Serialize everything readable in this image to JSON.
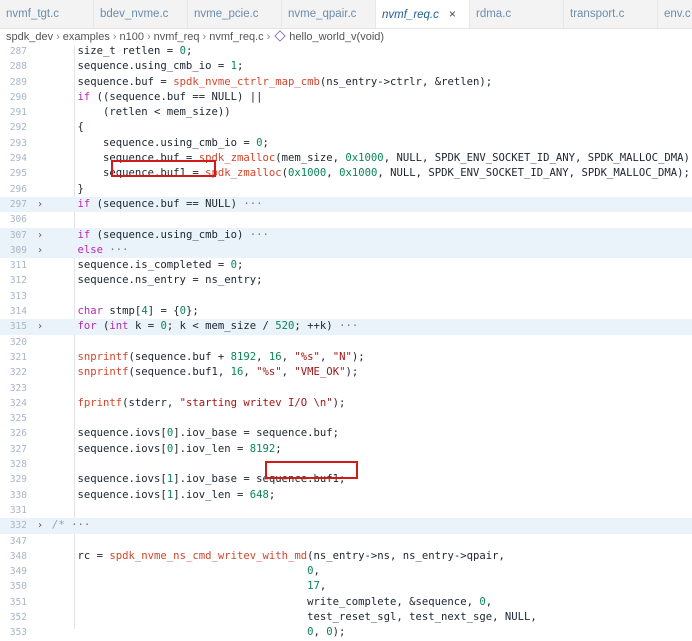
{
  "tabs": [
    {
      "label": "nvmf_tgt.c"
    },
    {
      "label": "bdev_nvme.c"
    },
    {
      "label": "nvme_pcie.c"
    },
    {
      "label": "nvme_qpair.c"
    },
    {
      "label": "nvmf_req.c",
      "close": "×"
    },
    {
      "label": "rdma.c"
    },
    {
      "label": "transport.c"
    },
    {
      "label": "env.c"
    }
  ],
  "breadcrumb": {
    "items": [
      "spdk_dev",
      "examples",
      "n100",
      "nvmf_req",
      "nvmf_req.c"
    ],
    "function": "hello_world_v(void)"
  },
  "colors": {
    "highlight_box": "#d11a1a",
    "keyword": "#b52ab5",
    "function": "#d5452b",
    "number": "#098658"
  },
  "lines": [
    {
      "n": "287",
      "t": "size_t retlen = 0;",
      "i": 4
    },
    {
      "n": "288",
      "t": "sequence.using_cmb_io = 1;",
      "i": 4
    },
    {
      "n": "289",
      "t": "sequence.buf = spdk_nvme_ctrlr_map_cmb(ns_entry->ctrlr, &retlen);",
      "i": 4
    },
    {
      "n": "290",
      "t": "if ((sequence.buf == NULL) ||",
      "i": 4
    },
    {
      "n": "291",
      "t": "(retlen < mem_size))",
      "i": 8
    },
    {
      "n": "292",
      "t": "{",
      "i": 4
    },
    {
      "n": "293",
      "t": "sequence.using_cmb_io = 0;",
      "i": 8
    },
    {
      "n": "294",
      "t": "sequence.buf = spdk_zmalloc(mem_size, 0x1000, NULL, SPDK_ENV_SOCKET_ID_ANY, SPDK_MALLOC_DMA);",
      "i": 8
    },
    {
      "n": "295",
      "t": "sequence.buf1 = spdk_zmalloc(0x1000, 0x1000, NULL, SPDK_ENV_SOCKET_ID_ANY, SPDK_MALLOC_DMA);",
      "i": 8
    },
    {
      "n": "296",
      "t": "}",
      "i": 4
    },
    {
      "n": "297",
      "t": "if (sequence.buf == NULL)",
      "i": 4,
      "fold": "›",
      "ell": "···"
    },
    {
      "n": "306",
      "t": "",
      "i": 0
    },
    {
      "n": "307",
      "t": "if (sequence.using_cmb_io)",
      "i": 4,
      "fold": "›",
      "ell": "···"
    },
    {
      "n": "309",
      "t": "else",
      "i": 4,
      "fold": "›",
      "ell": "···"
    },
    {
      "n": "311",
      "t": "sequence.is_completed = 0;",
      "i": 4
    },
    {
      "n": "312",
      "t": "sequence.ns_entry = ns_entry;",
      "i": 4
    },
    {
      "n": "313",
      "t": "",
      "i": 0
    },
    {
      "n": "314",
      "t": "char stmp[4] = {0};",
      "i": 4
    },
    {
      "n": "315",
      "t": "for (int k = 0; k < mem_size / 520; ++k)",
      "i": 4,
      "fold": "›",
      "ell": "···"
    },
    {
      "n": "320",
      "t": "",
      "i": 0
    },
    {
      "n": "321",
      "t": "snprintf(sequence.buf + 8192, 16, \"%s\", \"N\");",
      "i": 4
    },
    {
      "n": "322",
      "t": "snprintf(sequence.buf1, 16, \"%s\", \"VME_OK\");",
      "i": 4
    },
    {
      "n": "323",
      "t": "",
      "i": 0
    },
    {
      "n": "324",
      "t": "fprintf(stderr, \"starting writev I/O \\n\");",
      "i": 4
    },
    {
      "n": "325",
      "t": "",
      "i": 0
    },
    {
      "n": "326",
      "t": "sequence.iovs[0].iov_base = sequence.buf;",
      "i": 4
    },
    {
      "n": "327",
      "t": "sequence.iovs[0].iov_len = 8192;",
      "i": 4
    },
    {
      "n": "328",
      "t": "",
      "i": 0
    },
    {
      "n": "329",
      "t": "sequence.iovs[1].iov_base = sequence.buf1;",
      "i": 4
    },
    {
      "n": "330",
      "t": "sequence.iovs[1].iov_len = 648;",
      "i": 4
    },
    {
      "n": "331",
      "t": "",
      "i": 0
    },
    {
      "n": "332",
      "t": "/*",
      "i": 0,
      "fold": "›",
      "ell": "···",
      "comment": true
    },
    {
      "n": "347",
      "t": "",
      "i": 0
    },
    {
      "n": "348",
      "t": "rc = spdk_nvme_ns_cmd_writev_with_md(ns_entry->ns, ns_entry->qpair,",
      "i": 4
    },
    {
      "n": "349",
      "t": "0,",
      "i": 40
    },
    {
      "n": "350",
      "t": "17,",
      "i": 40
    },
    {
      "n": "351",
      "t": "write_complete, &sequence, 0,",
      "i": 40
    },
    {
      "n": "352",
      "t": "test_reset_sgl, test_next_sge, NULL,",
      "i": 40
    },
    {
      "n": "353",
      "t": "0, 0);",
      "i": 40
    }
  ]
}
